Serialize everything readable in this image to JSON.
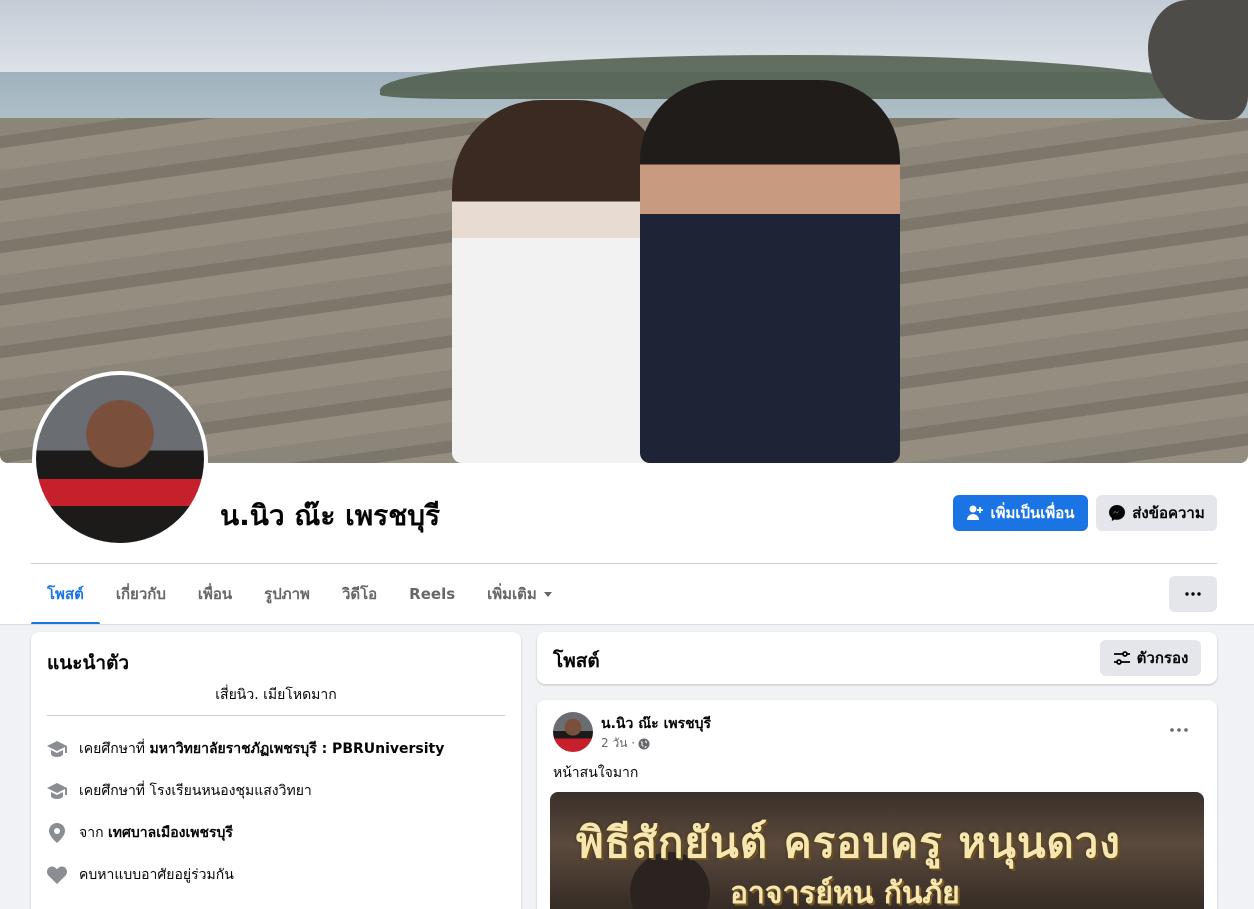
{
  "profile": {
    "name": "น.นิว ณ๊ะ เพรชบุรี",
    "add_friend_label": "เพิ่มเป็นเพื่อน",
    "message_label": "ส่งข้อความ"
  },
  "tabs": [
    {
      "label": "โพสต์",
      "active": true
    },
    {
      "label": "เกี่ยวกับ"
    },
    {
      "label": "เพื่อน"
    },
    {
      "label": "รูปภาพ"
    },
    {
      "label": "วิดีโอ"
    },
    {
      "label": "Reels"
    },
    {
      "label": "เพิ่มเติม"
    }
  ],
  "intro": {
    "title": "แนะนำตัว",
    "bio": "เสี่ยนิว. เมียโหดมาก",
    "items": [
      {
        "icon": "graduation-cap-icon",
        "prefix": "เคยศึกษาที่ ",
        "value": "มหาวิทยาลัยราชภัฏเพชรบุรี : PBRUniversity",
        "bold": true
      },
      {
        "icon": "graduation-cap-icon",
        "prefix": "เคยศึกษาที่ ",
        "value": "โรงเรียนหนองชุมแสงวิทยา",
        "bold": false
      },
      {
        "icon": "location-pin-icon",
        "prefix": "จาก ",
        "value": "เทศบาลเมืองเพชรบุรี",
        "bold": true
      },
      {
        "icon": "heart-icon",
        "prefix": "",
        "value": "คบหาแบบอาศัยอยู่ร่วมกัน",
        "bold": false
      }
    ]
  },
  "posts_header": {
    "title": "โพสต์",
    "filter_label": "ตัวกรอง"
  },
  "post": {
    "author": "น.นิว ณ๊ะ เพรชบุรี",
    "time": "2 วัน ·",
    "text": "หน้าสนใจมาก",
    "image_title_1": "พิธีสักยันต์ ครอบครู หนุนดวง",
    "image_title_2": "อาจารย์หน กันภัย"
  },
  "colors": {
    "accent": "#1b74e4",
    "secondary_button": "#e4e6eb",
    "background": "#f0f2f5"
  }
}
